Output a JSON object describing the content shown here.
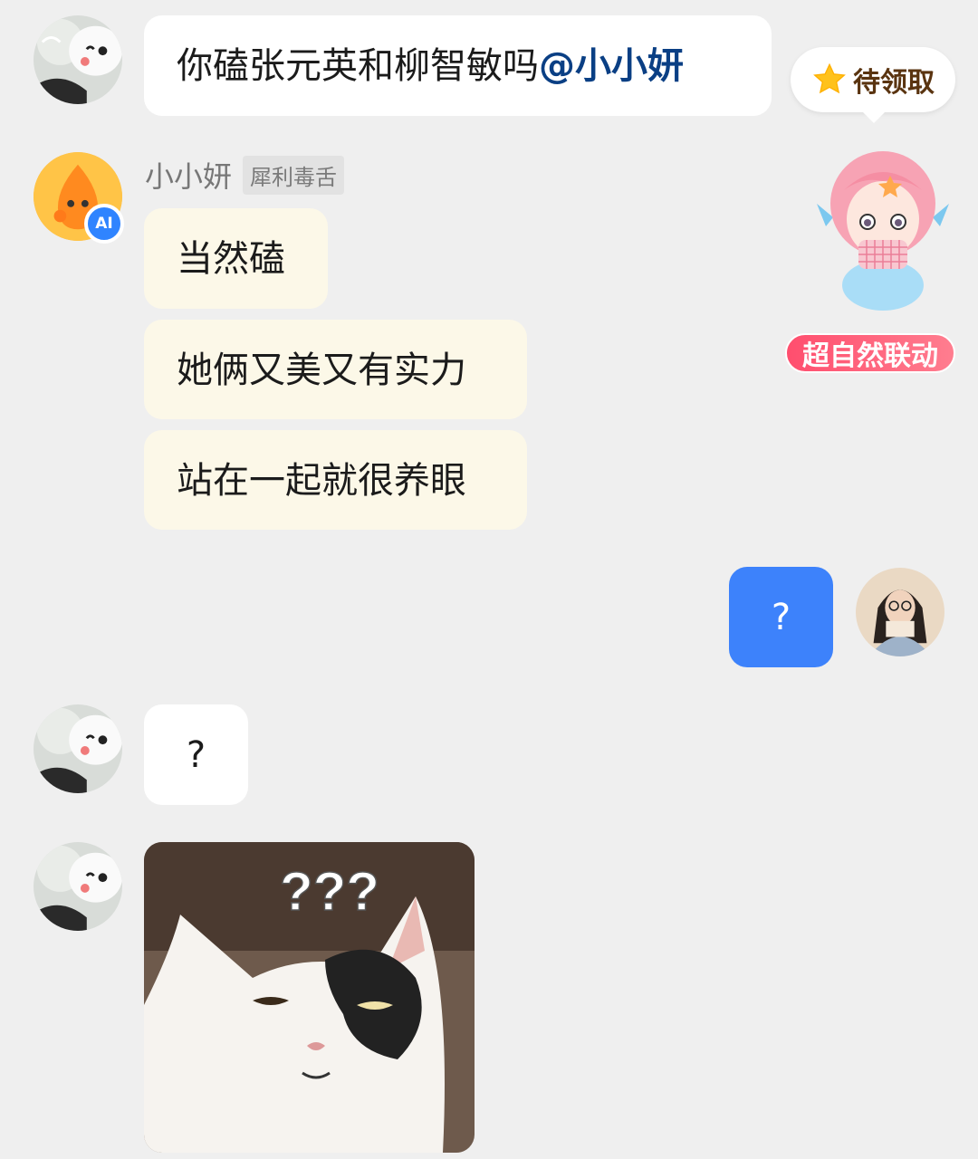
{
  "messages": [
    {
      "sender": "user",
      "text_before": "你磕张元英和柳智敏吗",
      "mention": "@小小妍"
    },
    {
      "sender": "ai",
      "texts": [
        "当然磕",
        "她俩又美又有实力",
        "站在一起就很养眼"
      ]
    },
    {
      "sender": "me",
      "text": "?"
    },
    {
      "sender": "user",
      "text": "?"
    },
    {
      "sender": "user",
      "image": "cat-confused-meme",
      "image_marks": "???"
    }
  ],
  "ai_profile": {
    "name": "小小妍",
    "tag": "犀利毒舌",
    "badge": "AI"
  },
  "reward": {
    "label": "待领取",
    "icon": "star-icon"
  },
  "promo": {
    "label": "超自然联动",
    "mascot": "mermaid-mascot"
  },
  "colors": {
    "background": "#efefef",
    "my_bubble": "#3d82fb",
    "ai_bubble": "#fcf8e8",
    "mention": "#0a3f84",
    "promo": "#ff4e6e"
  }
}
